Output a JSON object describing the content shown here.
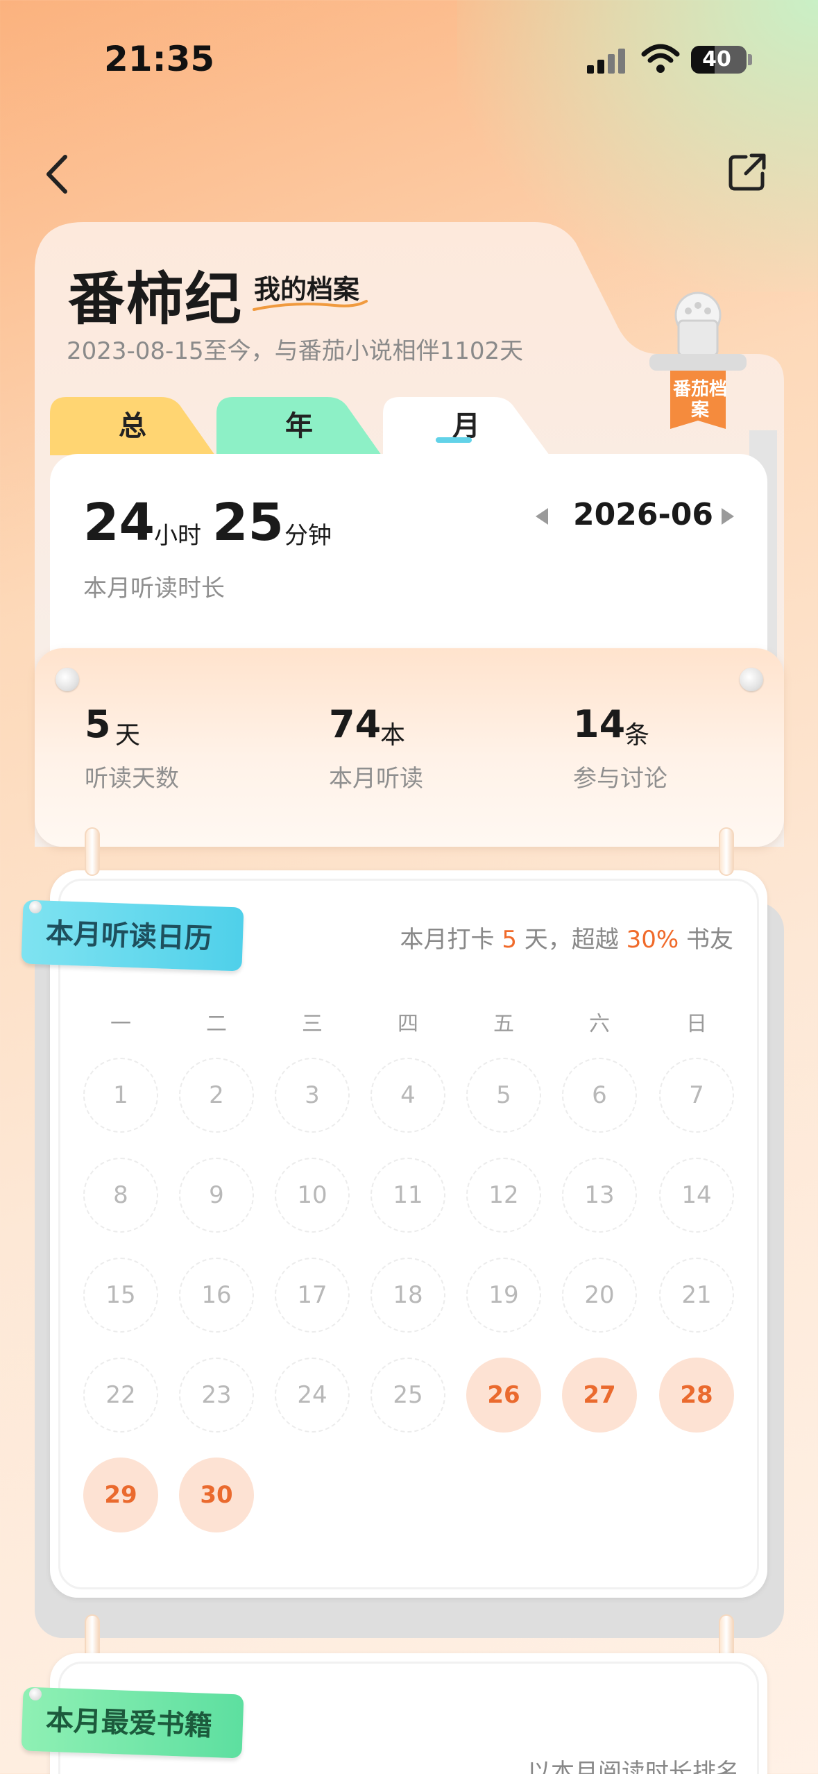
{
  "status_bar": {
    "time": "21:35",
    "battery": "40"
  },
  "header": {
    "title": "番柿纪",
    "subtitle_tag": "我的档案",
    "since_text": "2023-08-15至今，与番茄小说相伴1102天",
    "clip_tag": "番茄档案"
  },
  "tabs": [
    {
      "label": "总",
      "color": "#ffd572"
    },
    {
      "label": "年",
      "color": "#8df0c6"
    },
    {
      "label": "月",
      "color": "#ffffff",
      "active": true
    }
  ],
  "summary": {
    "hours": "24",
    "hours_unit": "小时",
    "minutes": "25",
    "minutes_unit": "分钟",
    "label": "本月听读时长",
    "month": "2026-06"
  },
  "stats": [
    {
      "value": "5",
      "unit": "天",
      "label": "听读天数"
    },
    {
      "value": "74",
      "unit": "本",
      "label": "本月听读"
    },
    {
      "value": "14",
      "unit": "条",
      "label": "参与讨论"
    }
  ],
  "calendar": {
    "title": "本月听读日历",
    "checkin_prefix": "本月打卡",
    "checkin_days": "5",
    "checkin_mid": "天，超越",
    "checkin_percent": "30%",
    "checkin_suffix": "书友",
    "weekdays": [
      "一",
      "二",
      "三",
      "四",
      "五",
      "六",
      "日"
    ],
    "days": [
      "1",
      "2",
      "3",
      "4",
      "5",
      "6",
      "7",
      "8",
      "9",
      "10",
      "11",
      "12",
      "13",
      "14",
      "15",
      "16",
      "17",
      "18",
      "19",
      "20",
      "21",
      "22",
      "23",
      "24",
      "25",
      "26",
      "27",
      "28",
      "29",
      "30"
    ],
    "active_days": [
      "26",
      "27",
      "28",
      "29",
      "30"
    ]
  },
  "favorites": {
    "title": "本月最爱书籍",
    "subtitle": "以本月阅读时长排名"
  }
}
